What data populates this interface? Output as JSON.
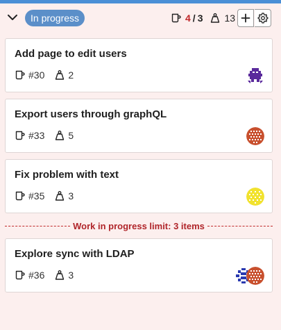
{
  "column": {
    "status_label": "In progress",
    "wip_current": "4",
    "wip_separator": "/",
    "wip_max": "3",
    "points_total": "13",
    "icons": {
      "collapse": "chevron-down-icon",
      "issue_count": "mug-icon",
      "points": "weight-icon",
      "add": "plus-icon",
      "settings": "gear-icon"
    },
    "colors": {
      "accent": "#4a8fd6",
      "status_pill": "#5b8fc9",
      "column_bg": "#fcefee",
      "wip_exceeded": "#c0282a"
    }
  },
  "cards": [
    {
      "title": "Add page to edit users",
      "issue_ref": "#30",
      "points": "2",
      "avatars": [
        "purple-pixel-avatar"
      ]
    },
    {
      "title": "Export users through graphQL",
      "issue_ref": "#33",
      "points": "5",
      "avatars": [
        "red-pattern-avatar"
      ]
    },
    {
      "title": "Fix problem with text",
      "issue_ref": "#35",
      "points": "3",
      "avatars": [
        "yellow-pattern-avatar"
      ]
    },
    {
      "title": "Explore sync with LDAP",
      "issue_ref": "#36",
      "points": "3",
      "avatars": [
        "blue-pattern-avatar",
        "red-pattern-avatar"
      ]
    }
  ],
  "wip_limit_text": "Work in progress limit: 3 items"
}
